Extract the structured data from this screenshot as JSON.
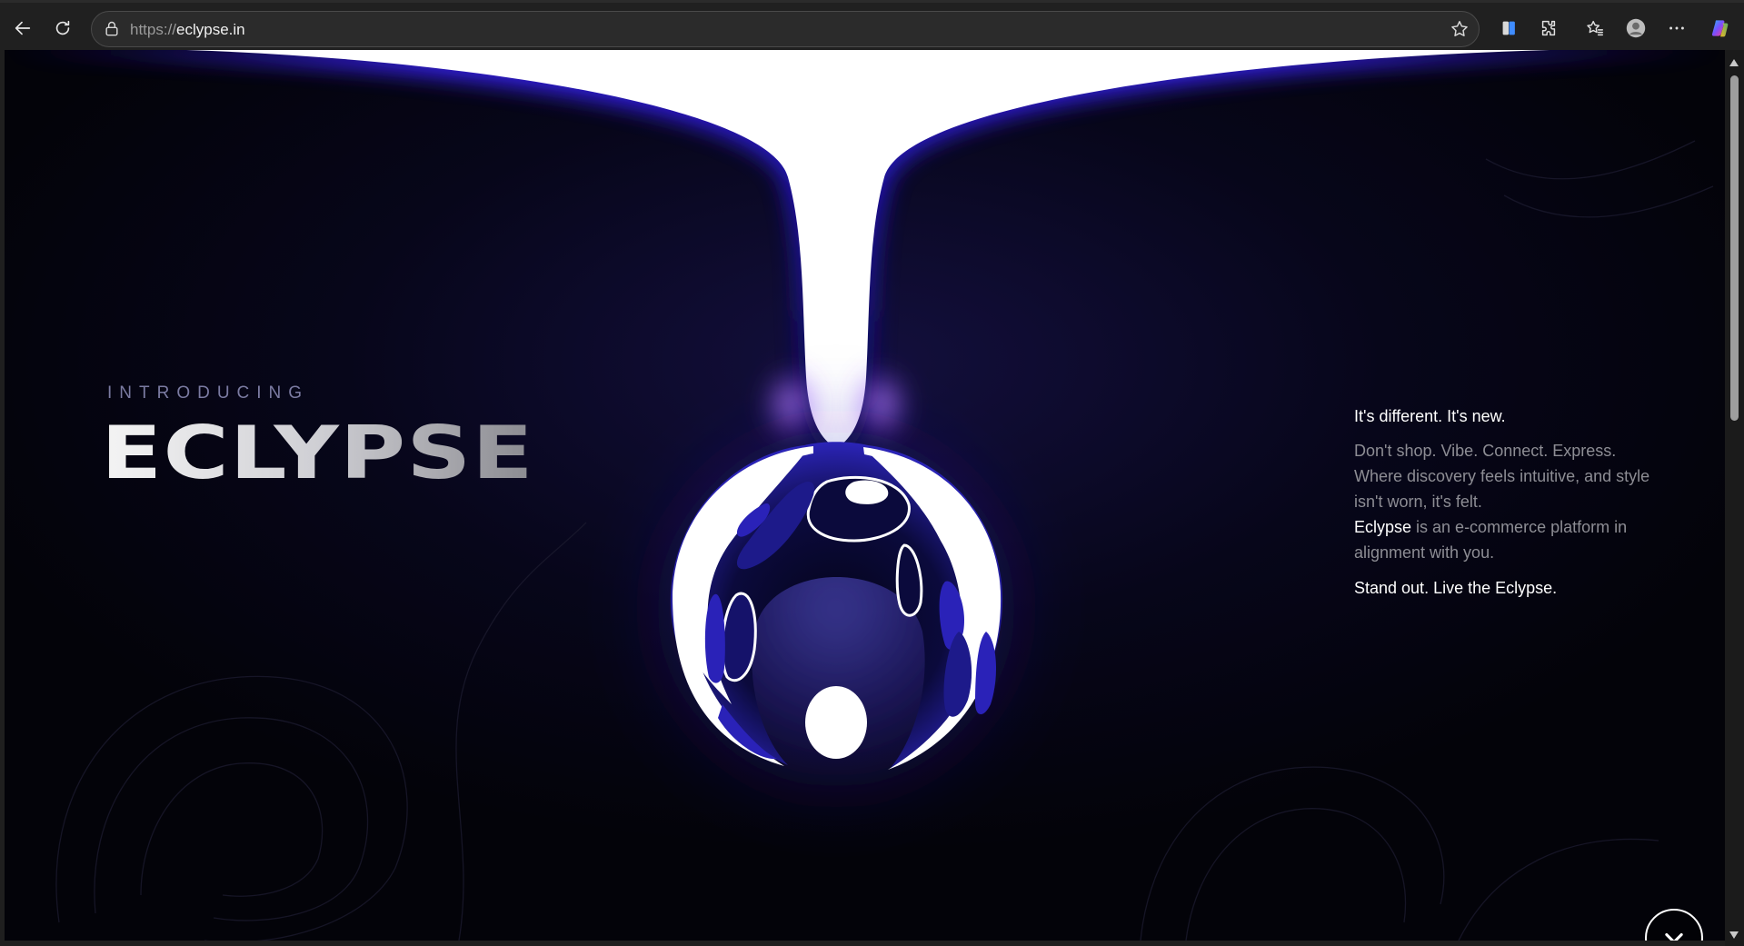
{
  "browser": {
    "url_scheme": "https://",
    "url_host": "eclypse.in",
    "icons": {
      "back": "back-arrow-icon",
      "reload": "reload-icon",
      "lock": "lock-icon",
      "favorite": "star-icon",
      "split_screen": "split-screen-icon",
      "extensions": "extensions-icon",
      "favorites": "favorites-icon",
      "profile": "profile-icon",
      "more": "more-icon",
      "copilot": "copilot-icon"
    }
  },
  "hero": {
    "intro": "INTRODUCING",
    "title": "ECLYPSE",
    "tagline_heading": "It's different. It's new.",
    "body_line_1": "Don't shop. Vibe. Connect. Express. Where discovery feels intuitive, and style isn't worn, it's felt.",
    "brand_inline": "Eclypse",
    "body_line_2": " is an e-commerce platform in alignment with you.",
    "tagline_footer": "Stand out. Live the Eclypse.",
    "scroll_icon": "chevron-down-icon"
  },
  "colors": {
    "background": "#04040b",
    "accent_purple": "#3a1fe0",
    "glow": "#b58cff",
    "text_white": "#ffffff",
    "text_muted": "#8d8d94"
  }
}
